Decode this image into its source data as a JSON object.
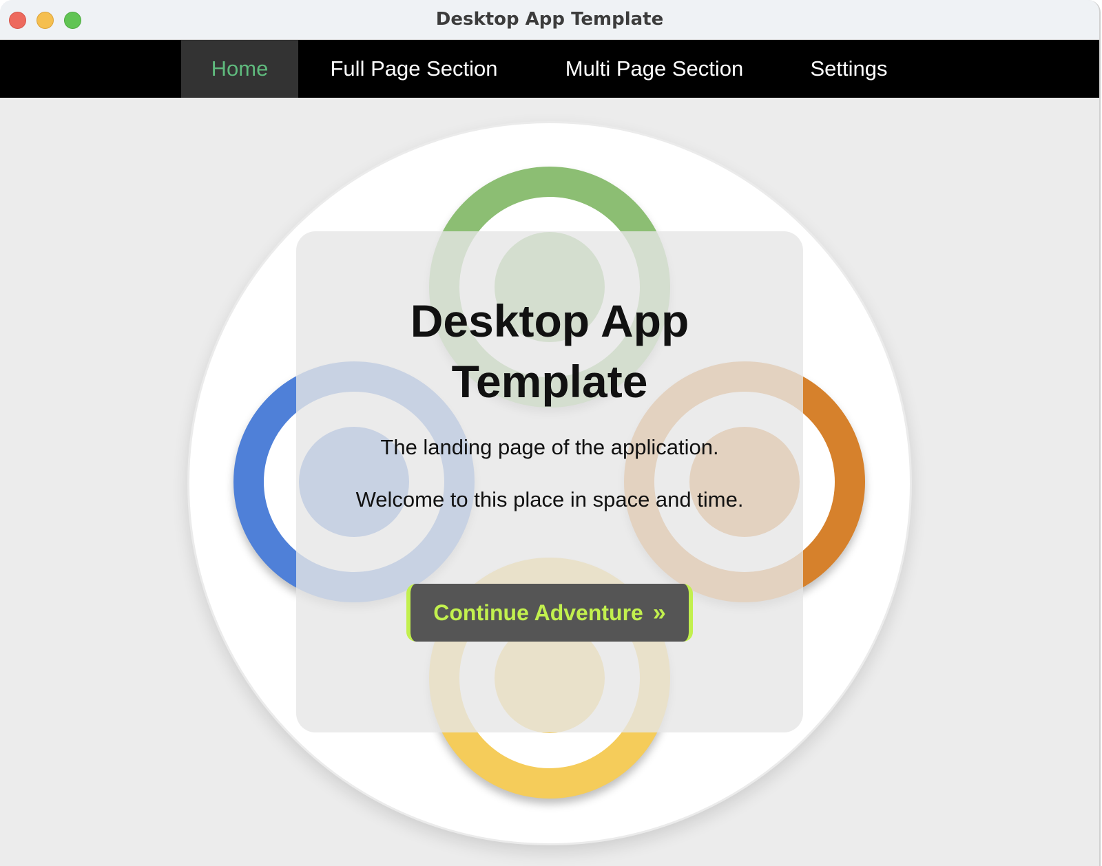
{
  "window": {
    "title": "Desktop App Template"
  },
  "nav": {
    "items": [
      {
        "label": "Home",
        "active": true
      },
      {
        "label": "Full Page Section",
        "active": false
      },
      {
        "label": "Multi Page Section",
        "active": false
      },
      {
        "label": "Settings",
        "active": false
      }
    ]
  },
  "hero": {
    "title": "Desktop App Template",
    "line1": "The landing page of the application.",
    "line2": "Welcome to this place in space and time.",
    "cta_label": "Continue Adventure",
    "cta_icon": "double-chevron-right-icon"
  },
  "colors": {
    "accent": "#c2f04e",
    "nav_active": "#5fba7d",
    "ring_green": "#8cbe73",
    "ring_blue": "#4f80d8",
    "ring_orange": "#d6812c",
    "ring_yellow": "#f5cc5a"
  }
}
